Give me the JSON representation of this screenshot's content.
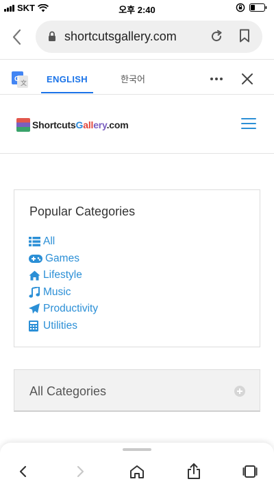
{
  "status_bar": {
    "carrier": "SKT",
    "time": "오후 2:40"
  },
  "browser": {
    "url": "shortcutsgallery.com"
  },
  "translate_bar": {
    "tab_english": "ENGLISH",
    "tab_korean": "한국어",
    "selected_tab": "ENGLISH"
  },
  "site": {
    "logo_part1": "Shortcuts",
    "logo_part2a": "G",
    "logo_part2b": "all",
    "logo_part2c": "ery",
    "logo_part3": ".com"
  },
  "popular": {
    "title": "Popular Categories",
    "items": [
      {
        "label": "All",
        "icon": "list-icon"
      },
      {
        "label": "Games",
        "icon": "gamepad-icon"
      },
      {
        "label": "Lifestyle",
        "icon": "home-icon"
      },
      {
        "label": "Music",
        "icon": "music-note-icon"
      },
      {
        "label": "Productivity",
        "icon": "paper-plane-icon"
      },
      {
        "label": "Utilities",
        "icon": "calculator-icon"
      }
    ]
  },
  "all_categories": {
    "label": "All Categories"
  },
  "colors": {
    "link_blue": "#2b8fd6",
    "translate_blue": "#1a73e8"
  }
}
